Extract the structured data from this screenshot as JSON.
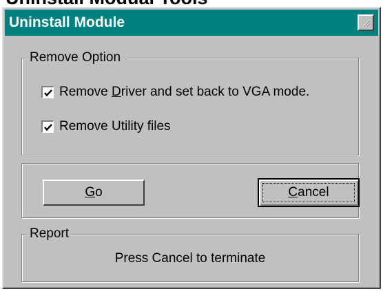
{
  "page_heading": "Uninstall Modual Tools",
  "window": {
    "title": "Uninstall Module",
    "title_bar_color": "#008080",
    "face_color": "#c0c0c0",
    "resize_icon": "size-grip-icon"
  },
  "remove_option": {
    "legend": "Remove Option",
    "options": [
      {
        "label_before": "Remove ",
        "accel": "D",
        "label_after": "river and set back to VGA mode.",
        "checked": true
      },
      {
        "label_before": "Remove Utility files",
        "accel": "",
        "label_after": "",
        "checked": true
      }
    ]
  },
  "actions": {
    "go": {
      "accel": "G",
      "rest": "o"
    },
    "cancel": {
      "accel": "C",
      "rest": "ancel"
    }
  },
  "report": {
    "legend": "Report",
    "text": "Press Cancel to terminate"
  }
}
